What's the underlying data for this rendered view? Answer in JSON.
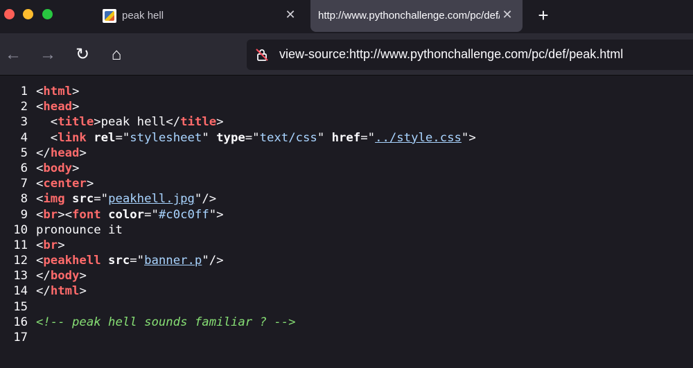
{
  "tabs": [
    {
      "title": "peak hell",
      "favicon": "pythonchallenge-favicon",
      "active": false
    },
    {
      "title": "http://www.pythonchallenge.com/pc/def/peak.html",
      "active": true
    }
  ],
  "new_tab_label": "+",
  "close_glyph": "✕",
  "nav": {
    "back_glyph": "←",
    "forward_glyph": "→",
    "reload_glyph": "↻",
    "home_glyph": "⌂",
    "url": "view-source:http://www.pythonchallenge.com/pc/def/peak.html"
  },
  "source_lines": [
    {
      "n": "1",
      "html": "&lt;<span class='tag'>html</span>&gt;"
    },
    {
      "n": "2",
      "html": "&lt;<span class='tag'>head</span>&gt;"
    },
    {
      "n": "3",
      "html": "  &lt;<span class='tag'>title</span>&gt;peak hell&lt;/<span class='tag'>title</span>&gt;"
    },
    {
      "n": "4",
      "html": "  &lt;<span class='tag'>link</span> <span class='attr'>rel</span>=\"<span class='val'>stylesheet</span>\" <span class='attr'>type</span>=\"<span class='val'>text/css</span>\" <span class='attr'>href</span>=\"<span class='link'>../style.css</span>\"&gt;"
    },
    {
      "n": "5",
      "html": "&lt;/<span class='tag'>head</span>&gt;"
    },
    {
      "n": "6",
      "html": "&lt;<span class='tag'>body</span>&gt;"
    },
    {
      "n": "7",
      "html": "&lt;<span class='tag'>center</span>&gt;"
    },
    {
      "n": "8",
      "html": "&lt;<span class='tag'>img</span> <span class='attr'>src</span>=\"<span class='link'>peakhell.jpg</span>\"/&gt;"
    },
    {
      "n": "9",
      "html": "&lt;<span class='tag'>br</span>&gt;&lt;<span class='tag'>font</span> <span class='attr'>color</span>=\"<span class='val'>#c0c0ff</span>\"&gt;"
    },
    {
      "n": "10",
      "html": "pronounce it"
    },
    {
      "n": "11",
      "html": "&lt;<span class='tag'>br</span>&gt;"
    },
    {
      "n": "12",
      "html": "&lt;<span class='tag'>peakhell</span> <span class='attr'>src</span>=\"<span class='link'>banner.p</span>\"/&gt;"
    },
    {
      "n": "13",
      "html": "&lt;/<span class='tag'>body</span>&gt;"
    },
    {
      "n": "14",
      "html": "&lt;/<span class='tag'>html</span>&gt;"
    },
    {
      "n": "15",
      "html": ""
    },
    {
      "n": "16",
      "html": "<span class='comment'>&lt;!-- peak hell sounds familiar ? --&gt;</span>"
    },
    {
      "n": "17",
      "html": ""
    }
  ],
  "colors": {
    "background": "#1c1b22",
    "toolbar": "#2b2a33",
    "active_tab": "#42414d",
    "tag": "#ff6b6b",
    "value": "#a9d4ff",
    "comment": "#86de74"
  }
}
